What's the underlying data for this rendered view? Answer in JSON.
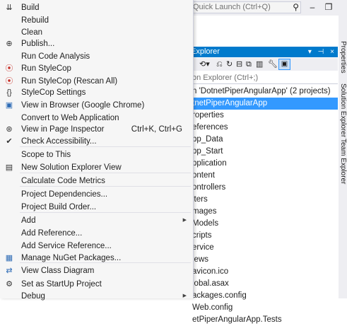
{
  "background": {
    "quick_launch": "Quick Launch (Ctrl+Q)",
    "search_icon": "⚲",
    "window_buttons": [
      "–",
      "❐"
    ],
    "solution_explorer": {
      "title": "Explorer",
      "title_icons": "▾ ⊣ ×",
      "search_placeholder": "on Explorer (Ctrl+;)",
      "tree": [
        "n 'DotnetPiperAngularApp' (2 projects)",
        "tnetPiperAngularApp",
        "roperties",
        "eferences",
        "pp_Data",
        "pp_Start",
        "pplication",
        "ontent",
        "ontrollers",
        "lters",
        "mages",
        "Models",
        "cripts",
        "ervice",
        "iews",
        "avicon.ico",
        "lobal.asax",
        "ackages.config",
        "Web.config",
        "etPiperAngularApp.Tests"
      ],
      "selected_index": 1
    },
    "vertical_tabs": [
      "Properties",
      "Solution Explorer",
      "Team Explorer"
    ]
  },
  "menu": {
    "items": [
      {
        "icon": "build-icon",
        "glyph": "⇊",
        "label": "Build",
        "top": 0
      },
      {
        "icon": "",
        "glyph": "",
        "label": "Rebuild"
      },
      {
        "icon": "",
        "glyph": "",
        "label": "Clean"
      },
      {
        "icon": "publish-icon",
        "glyph": "⊕",
        "label": "Publish..."
      },
      {
        "icon": "",
        "glyph": "",
        "label": "Run Code Analysis"
      },
      {
        "icon": "stylecop-icon",
        "glyph": "⦿",
        "label": "Run StyleCop"
      },
      {
        "icon": "stylecop-rescan-icon",
        "glyph": "⦿",
        "label": "Run StyleCop (Rescan All)"
      },
      {
        "icon": "braces-icon",
        "glyph": "{}",
        "label": "StyleCop Settings"
      },
      {
        "icon": "browser-icon",
        "glyph": "▣",
        "label": "View in Browser (Google Chrome)"
      },
      {
        "icon": "",
        "glyph": "",
        "label": "Convert to Web Application"
      },
      {
        "icon": "inspector-icon",
        "glyph": "⊛",
        "label": "View in Page Inspector",
        "shortcut": "Ctrl+K, Ctrl+G"
      },
      {
        "icon": "check-icon",
        "glyph": "✔",
        "label": "Check Accessibility..."
      },
      {
        "icon": "",
        "glyph": "",
        "label": "Scope to This"
      },
      {
        "icon": "solution-explorer-icon",
        "glyph": "▤",
        "label": "New Solution Explorer View"
      },
      {
        "icon": "",
        "glyph": "",
        "label": "Calculate Code Metrics"
      },
      {
        "icon": "",
        "glyph": "",
        "label": "Project Dependencies..."
      },
      {
        "icon": "",
        "glyph": "",
        "label": "Project Build Order..."
      },
      {
        "icon": "",
        "glyph": "",
        "label": "Add",
        "submenu": true
      },
      {
        "icon": "",
        "glyph": "",
        "label": "Add Reference..."
      },
      {
        "icon": "",
        "glyph": "",
        "label": "Add Service Reference..."
      },
      {
        "icon": "nuget-icon",
        "glyph": "▦",
        "label": "Manage NuGet Packages..."
      },
      {
        "icon": "class-diagram-icon",
        "glyph": "⇄",
        "label": "View Class Diagram"
      },
      {
        "icon": "gear-icon",
        "glyph": "⚙",
        "label": "Set as StartUp Project"
      },
      {
        "icon": "",
        "glyph": "",
        "label": "Debug",
        "submenu": true
      }
    ],
    "submenu_arrow": "▶"
  }
}
